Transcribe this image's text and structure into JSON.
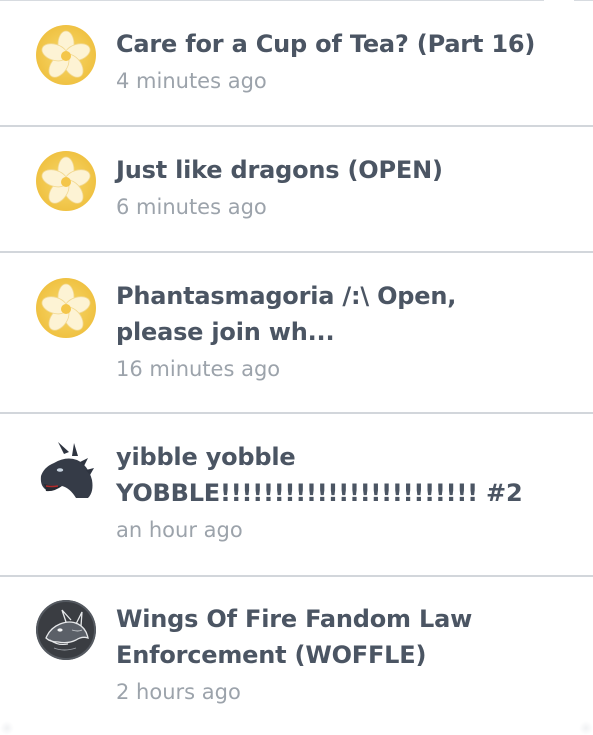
{
  "feed": {
    "items": [
      {
        "title_lines": [
          "Care for a Cup of Tea? (Part 16)"
        ],
        "time": "4 minutes ago",
        "avatar_icon": "plumeria-flower-icon"
      },
      {
        "title_lines": [
          "Just like dragons (OPEN)"
        ],
        "time": "6 minutes ago",
        "avatar_icon": "plumeria-flower-icon"
      },
      {
        "title_lines": [
          "Phantasmagoria /:\\ Open,",
          "please join wh..."
        ],
        "time": "16 minutes ago",
        "avatar_icon": "plumeria-flower-icon"
      },
      {
        "title_lines": [
          "yibble yobble",
          "YOBBLE!!!!!!!!!!!!!!!!!!!!!!!! #2"
        ],
        "time": "an hour ago",
        "avatar_icon": "dragon-head-icon"
      },
      {
        "title_lines": [
          "Wings Of Fire Fandom Law",
          "Enforcement (WOFFLE)"
        ],
        "time": "2 hours ago",
        "avatar_icon": "dragon-sketch-icon"
      }
    ]
  },
  "colors": {
    "title": "#4b5563",
    "time": "#9ca3ab",
    "divider": "#d2d6db",
    "flower_bg": "#f3c94a",
    "flower_petal": "#fdf3d4"
  }
}
